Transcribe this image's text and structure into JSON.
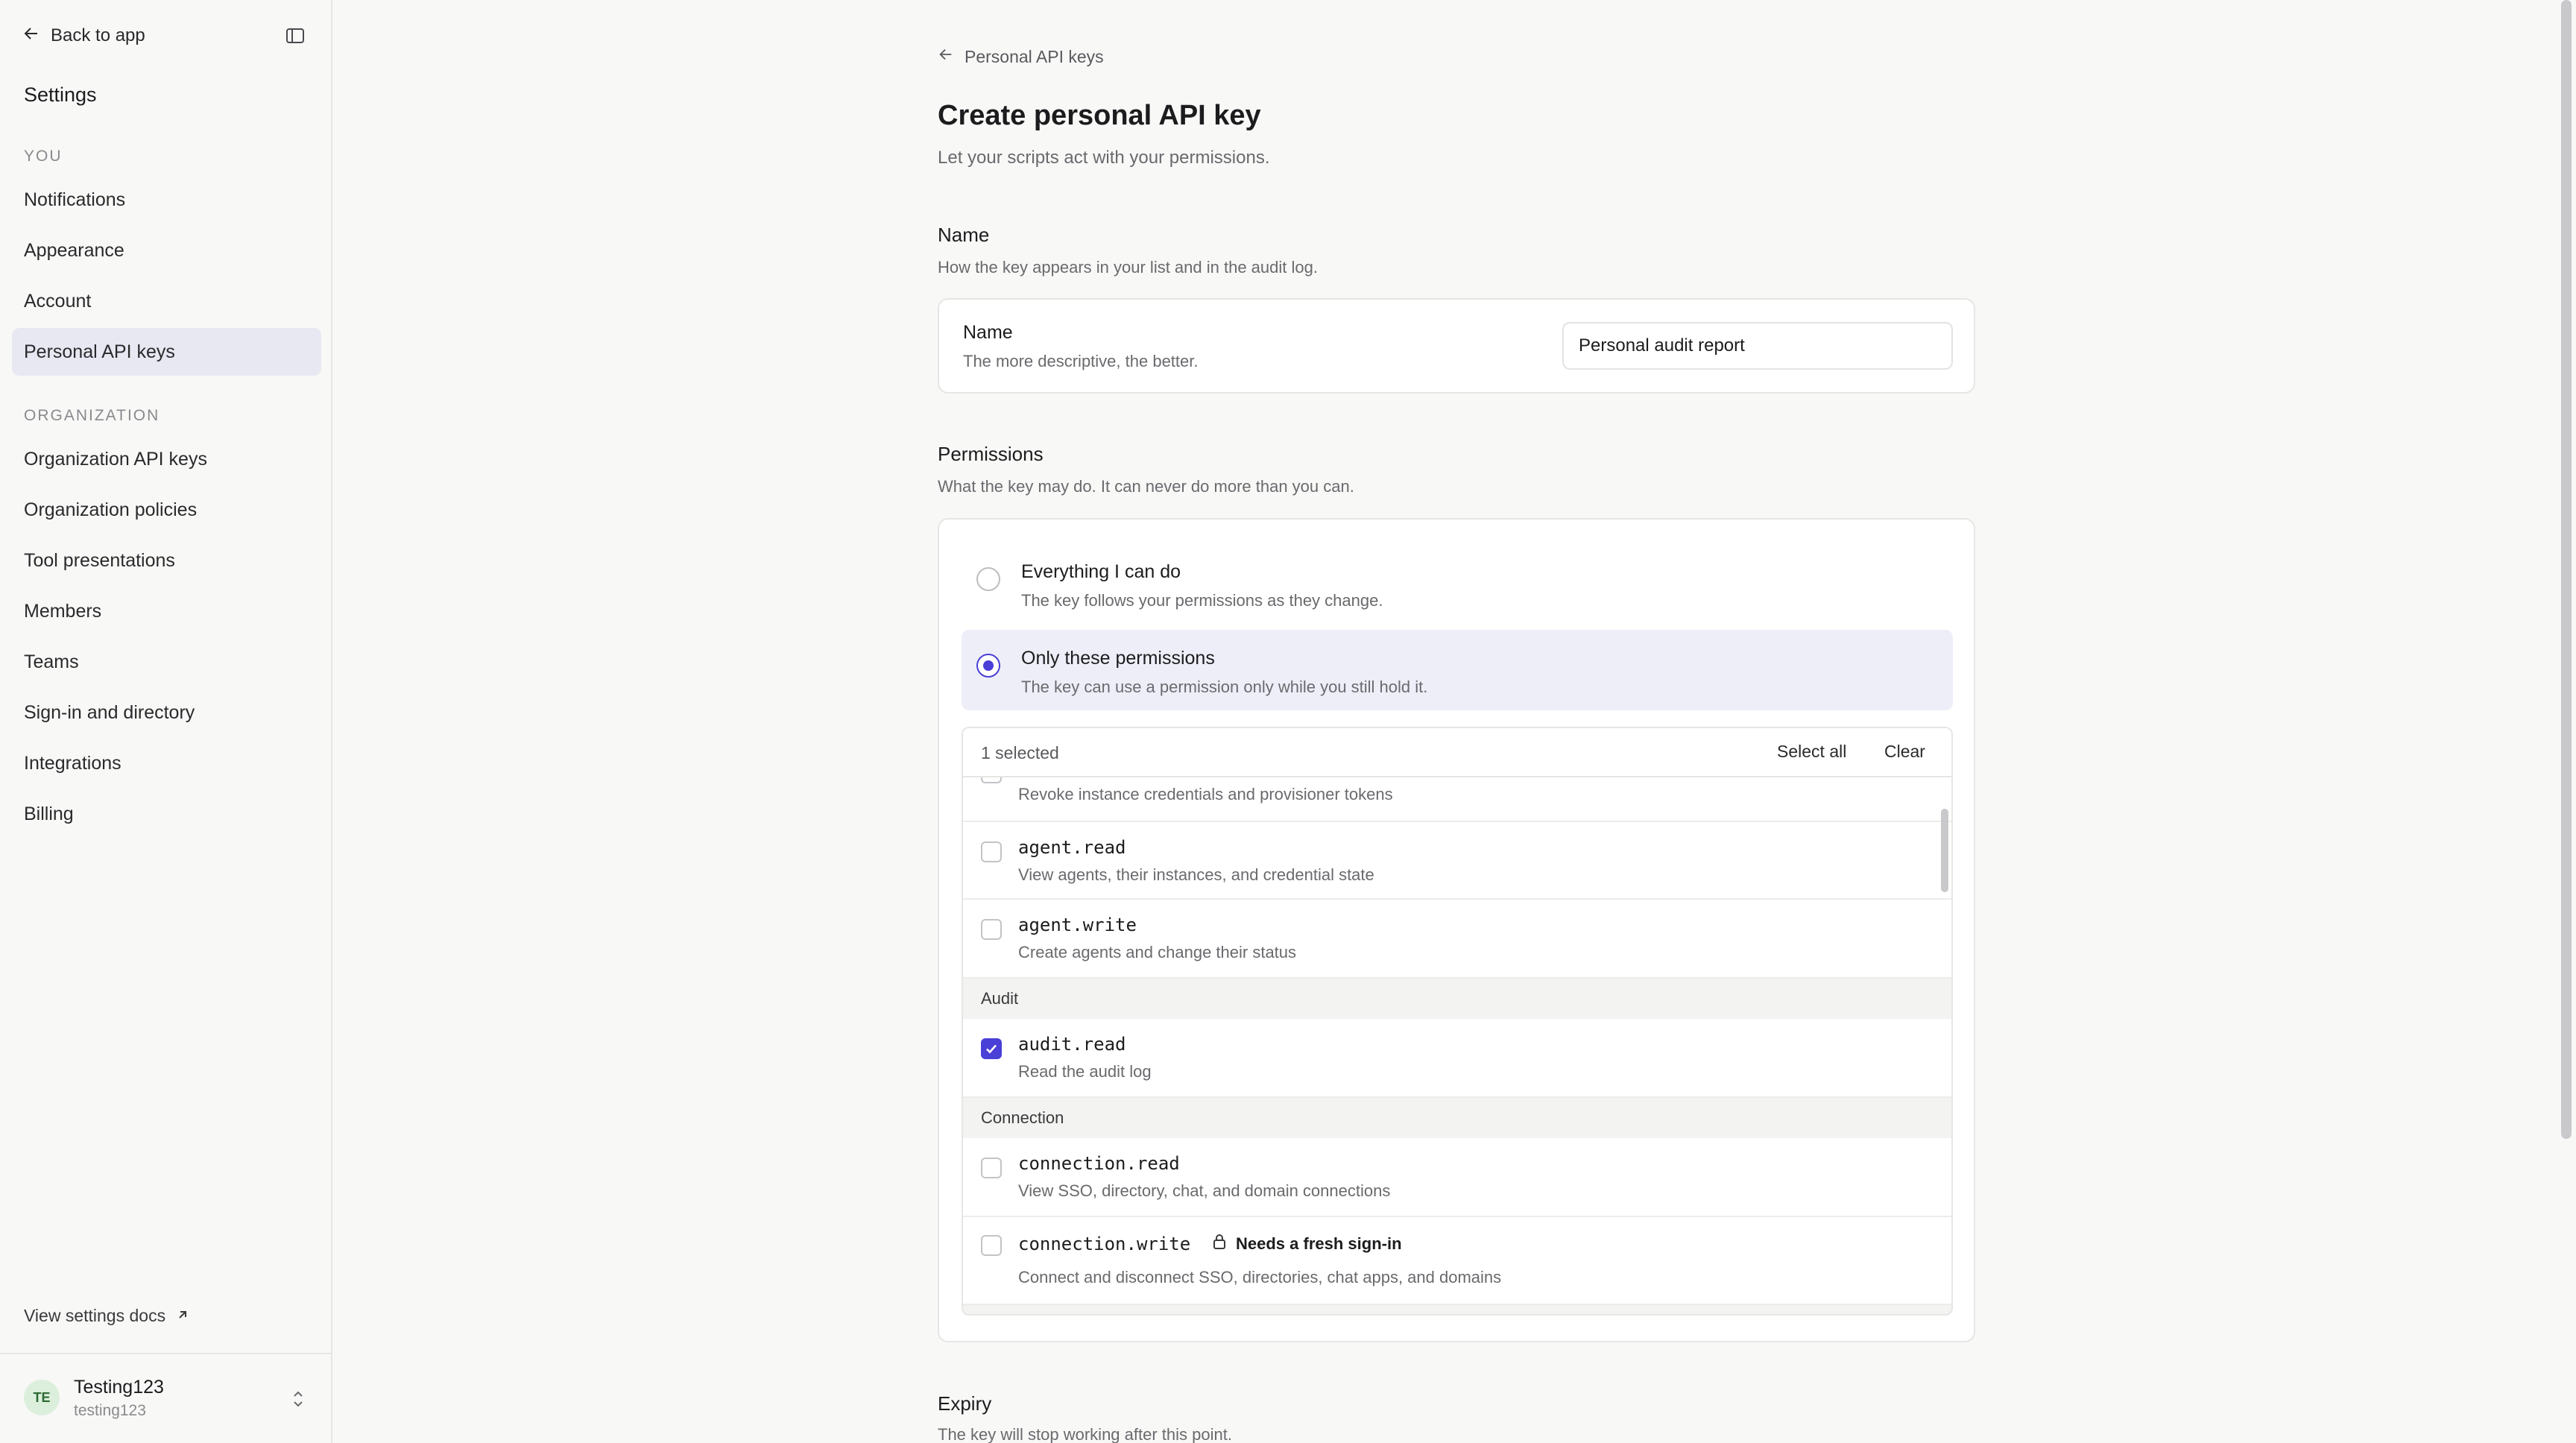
{
  "sidebar": {
    "back_label": "Back to app",
    "title": "Settings",
    "you_label": "YOU",
    "you_items": [
      "Notifications",
      "Appearance",
      "Account",
      "Personal API keys"
    ],
    "org_label": "ORGANIZATION",
    "org_items": [
      "Organization API keys",
      "Organization policies",
      "Tool presentations",
      "Members",
      "Teams",
      "Sign-in and directory",
      "Integrations",
      "Billing"
    ],
    "active_item": "Personal API keys",
    "docs_link": "View settings docs",
    "user": {
      "initials": "TE",
      "name": "Testing123",
      "handle": "testing123"
    }
  },
  "main": {
    "breadcrumb": "Personal API keys",
    "title": "Create personal API key",
    "subtitle": "Let your scripts act with your permissions.",
    "name_section": {
      "title": "Name",
      "description": "How the key appears in your list and in the audit log.",
      "field_label": "Name",
      "field_hint": "The more descriptive, the better.",
      "value": "Personal audit report"
    },
    "permissions_section": {
      "title": "Permissions",
      "description": "What the key may do. It can never do more than you can.",
      "options": [
        {
          "title": "Everything I can do",
          "description": "The key follows your permissions as they change.",
          "selected": false
        },
        {
          "title": "Only these permissions",
          "description": "The key can use a permission only while you still hold it.",
          "selected": true
        }
      ],
      "list": {
        "selected_count": "1 selected",
        "select_all": "Select all",
        "clear": "Clear",
        "partial_row_desc": "Revoke instance credentials and provisioner tokens",
        "rows": [
          {
            "name": "agent.read",
            "desc": "View agents, their instances, and credential state",
            "checked": false
          },
          {
            "name": "agent.write",
            "desc": "Create agents and change their status",
            "checked": false
          }
        ],
        "audit_group": "Audit",
        "audit_rows": [
          {
            "name": "audit.read",
            "desc": "Read the audit log",
            "checked": true
          }
        ],
        "connection_group": "Connection",
        "connection_rows": [
          {
            "name": "connection.read",
            "desc": "View SSO, directory, chat, and domain connections",
            "checked": false
          },
          {
            "name": "connection.write",
            "desc": "Connect and disconnect SSO, directories, chat apps, and domains",
            "checked": false,
            "badge": "Needs a fresh sign-in"
          }
        ]
      }
    },
    "expiry_section": {
      "title": "Expiry",
      "description": "The key will stop working after this point."
    }
  },
  "colors": {
    "accent": "#4a3fd6",
    "active_nav": "#e8e8f3",
    "selected_option": "#eeeef9"
  }
}
